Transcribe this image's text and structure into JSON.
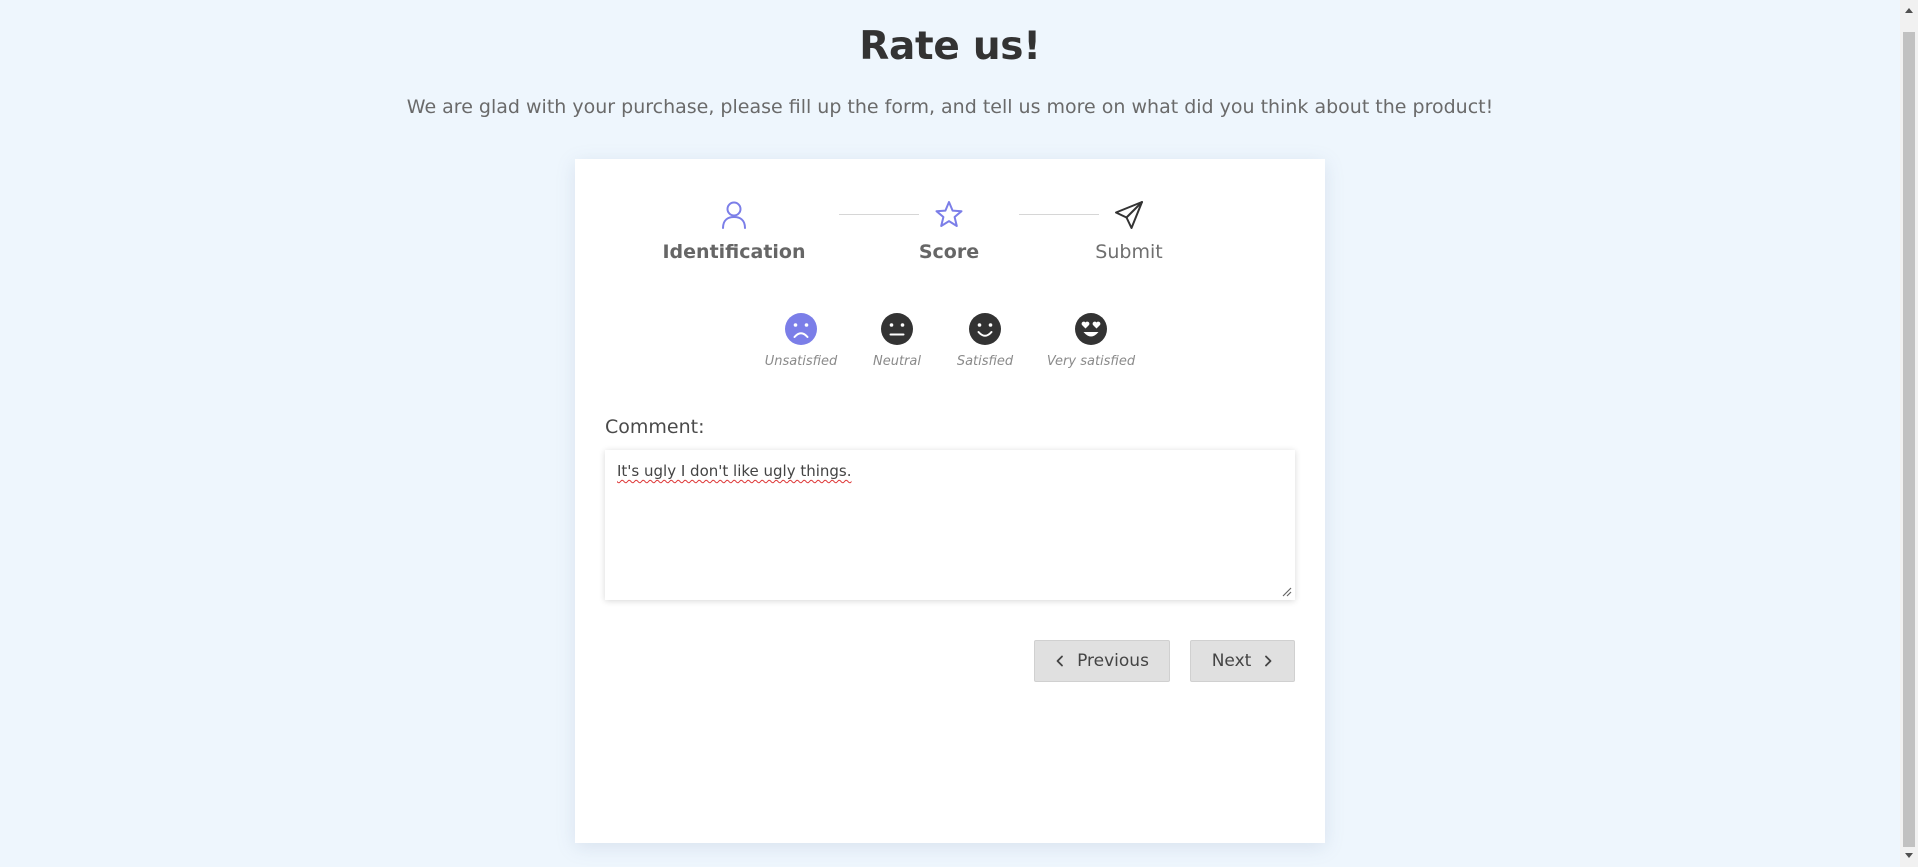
{
  "header": {
    "title": "Rate us!",
    "subtitle": "We are glad with your purchase, please fill up the form, and tell us more on what did you think about the product!"
  },
  "stepper": {
    "steps": [
      {
        "label": "Identification",
        "icon": "user-icon",
        "state": "done"
      },
      {
        "label": "Score",
        "icon": "star-icon",
        "state": "active"
      },
      {
        "label": "Submit",
        "icon": "send-icon",
        "state": "pending"
      }
    ]
  },
  "ratings": {
    "selected": "Unsatisfied",
    "options": [
      {
        "label": "Unsatisfied",
        "icon": "frown-face-icon"
      },
      {
        "label": "Neutral",
        "icon": "neutral-face-icon"
      },
      {
        "label": "Satisfied",
        "icon": "smile-face-icon"
      },
      {
        "label": "Very satisfied",
        "icon": "heart-eyes-face-icon"
      }
    ]
  },
  "comment": {
    "label": "Comment:",
    "value": "It's ugly I don't like ugly things."
  },
  "buttons": {
    "previous": "Previous",
    "next": "Next"
  },
  "colors": {
    "accent": "#7b7ee8",
    "background": "#eef6fd",
    "card": "#ffffff",
    "face_default": "#333333",
    "button": "#e0e0e0"
  }
}
